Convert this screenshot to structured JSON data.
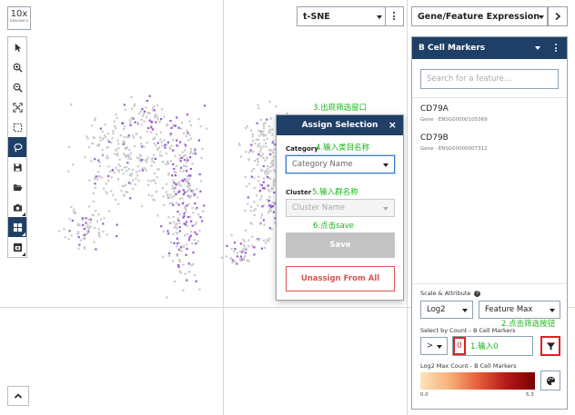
{
  "logo": {
    "big": "10x",
    "small": "GENOMICS"
  },
  "toolbar": {
    "tools": [
      "pointer-icon",
      "zoom-in-icon",
      "zoom-out-icon",
      "fit-view-icon",
      "box-select-icon",
      "lasso-icon",
      "save-icon",
      "folder-open-icon",
      "camera-icon",
      "layout-grid-icon",
      "screenshot-icon"
    ],
    "active": [
      "lasso-icon",
      "layout-grid-icon"
    ]
  },
  "projection": {
    "selected": "t-SNE"
  },
  "panel_type": {
    "selected": "Gene/Feature Expression"
  },
  "plot": {
    "axis_label": "t"
  },
  "dialog": {
    "title": "Assign Selection",
    "close": "×",
    "category_label": "Category",
    "category_placeholder": "Category Name",
    "cluster_label": "Cluster",
    "cluster_placeholder": "Cluster Name",
    "save_label": "Save",
    "unassign_label": "Unassign From All"
  },
  "panel": {
    "title": "B Cell Markers",
    "search_placeholder": "Search for a feature...",
    "genes": [
      {
        "name": "CD79A",
        "id": "Gene · ENSG00000105369"
      },
      {
        "name": "CD79B",
        "id": "Gene · ENSG00000007312"
      }
    ],
    "scale_label": "Scale & Attribute",
    "scale_help": "?",
    "scale_value": "Log2",
    "attribute_value": "Feature Max",
    "select_by_count_label": "Select by Count - B Cell Markers",
    "operator_value": ">",
    "count_value": "0",
    "legend_label": "Log2 Max Count - B Cell Markers",
    "legend_min": "0.0",
    "legend_max": "5.3",
    "colors": [
      "#fde3b8",
      "#f6b27a",
      "#e6603a",
      "#b51a1a",
      "#7a0000"
    ]
  },
  "annotations": {
    "a3": "3.出现筛选窗口",
    "a4": "4.输入类目名称",
    "a5": "5.输入群名称",
    "a6": "6.点击save",
    "a2": "2.点击筛选按钮",
    "a1": "1.输入0"
  },
  "colors": {
    "navy": "#1f3f66",
    "selected_cell": "#9b59d0",
    "unselected_cell": "#c9c9c9",
    "annotation": "#1bb51b",
    "highlight": "#e02020"
  }
}
